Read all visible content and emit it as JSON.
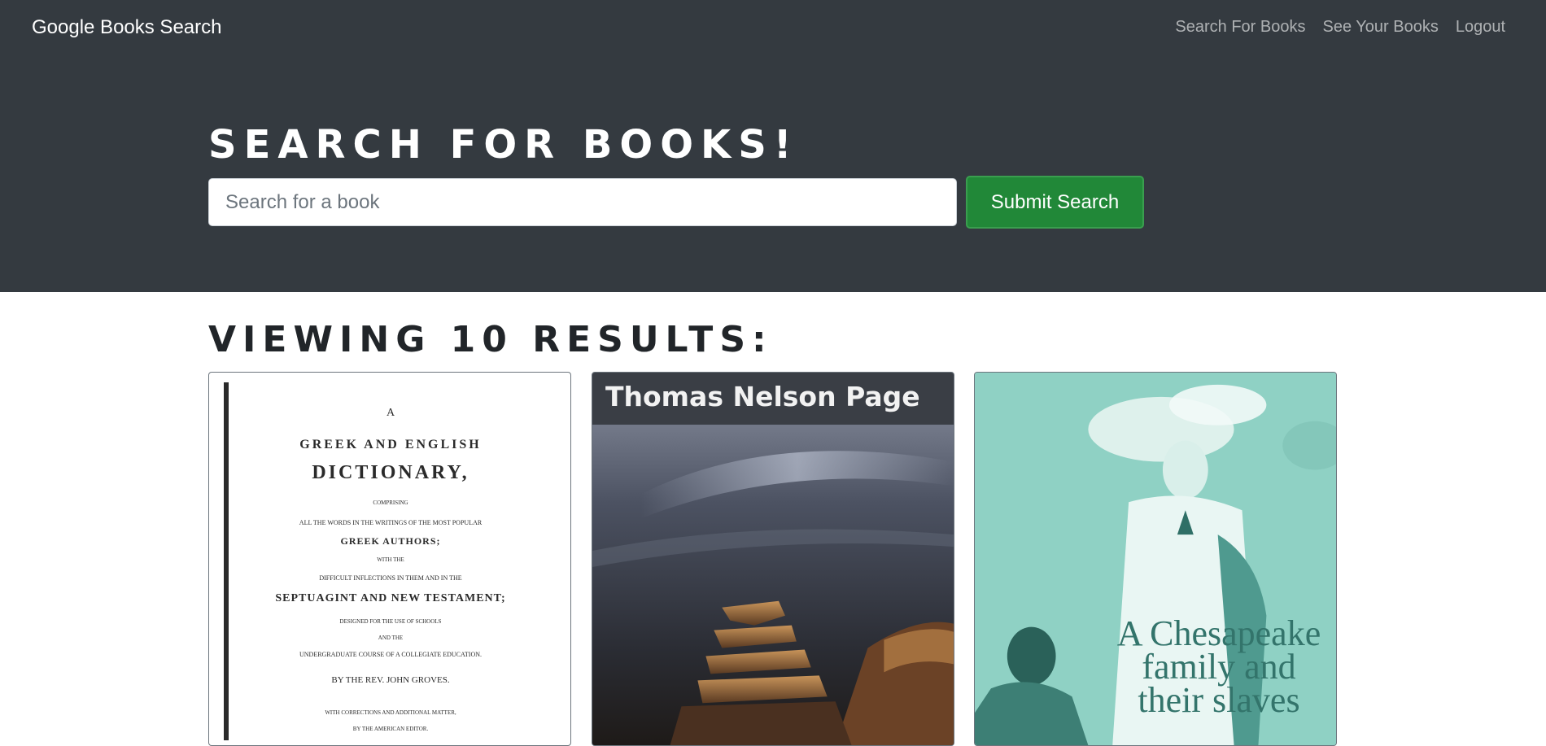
{
  "nav": {
    "brand": "Google Books Search",
    "links": [
      "Search For Books",
      "See Your Books",
      "Logout"
    ]
  },
  "search": {
    "title": "Search for Books!",
    "placeholder": "Search for a book",
    "value": "",
    "submit_label": "Submit Search"
  },
  "results": {
    "title": "Viewing 10 results:",
    "books": [
      {
        "cover_lines": [
          "A",
          "GREEK AND ENGLISH",
          "DICTIONARY,",
          "COMPRISING",
          "ALL THE WORDS IN THE WRITINGS OF THE MOST POPULAR",
          "GREEK AUTHORS;",
          "WITH THE",
          "DIFFICULT INFLECTIONS IN THEM AND IN THE",
          "SEPTUAGINT AND NEW TESTAMENT;",
          "DESIGNED FOR THE USE OF SCHOOLS",
          "AND THE",
          "UNDERGRADUATE COURSE OF A COLLEGIATE EDUCATION.",
          "BY THE REV. JOHN GROVES.",
          "WITH CORRECTIONS AND ADDITIONAL MATTER,",
          "BY THE AMERICAN EDITOR."
        ],
        "cover_color": "#ffffff"
      },
      {
        "cover_author": "Thomas Nelson Page",
        "cover_color": "#2c3038"
      },
      {
        "cover_title_lines": [
          "A Chesapeake",
          "family and",
          "their slaves"
        ],
        "cover_color": "#8fd1c4"
      }
    ]
  }
}
